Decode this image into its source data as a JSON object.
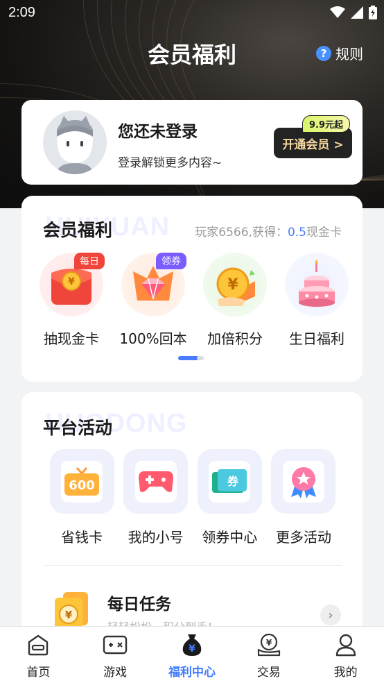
{
  "status": {
    "time": "2:09"
  },
  "header": {
    "title": "会员福利",
    "rules_label": "规则",
    "rules_icon": "question-icon"
  },
  "login": {
    "title": "您还未登录",
    "subtitle": "登录解锁更多内容~",
    "open_button": "开通会员 >",
    "price_tag": "9.9元起"
  },
  "benefits": {
    "heading": "会员福利",
    "watermark": "HUIYUAN",
    "note_prefix": "玩家6566,获得：",
    "note_value": "0.5",
    "note_suffix": "现金卡",
    "items": [
      {
        "label": "抽现金卡",
        "badge": "每日",
        "icon": "red-envelope-icon"
      },
      {
        "label": "100%回本",
        "badge": "领券",
        "icon": "gem-icon"
      },
      {
        "label": "加倍积分",
        "badge": "",
        "icon": "coin-icon"
      },
      {
        "label": "生日福利",
        "badge": "",
        "icon": "cake-icon"
      }
    ],
    "pager_active": 0
  },
  "platform": {
    "heading": "平台活动",
    "watermark": "HUODONG",
    "items": [
      {
        "label": "省钱卡",
        "icon": "gift-600-icon",
        "icon_text": "600"
      },
      {
        "label": "我的小号",
        "icon": "gamepad-icon",
        "icon_text": ""
      },
      {
        "label": "领券中心",
        "icon": "coupon-icon",
        "icon_text": "券"
      },
      {
        "label": "更多活动",
        "icon": "ribbon-badge-icon",
        "icon_text": ""
      }
    ],
    "task": {
      "title": "每日任务",
      "subtitle": "轻轻松松，积分到手！",
      "icon": "coin-card-icon"
    }
  },
  "tabs": [
    {
      "label": "首页",
      "icon": "home-icon",
      "active": false
    },
    {
      "label": "游戏",
      "icon": "game-icon",
      "active": false
    },
    {
      "label": "福利中心",
      "icon": "money-bag-icon",
      "active": true
    },
    {
      "label": "交易",
      "icon": "trade-icon",
      "active": false
    },
    {
      "label": "我的",
      "icon": "profile-icon",
      "active": false
    }
  ],
  "colors": {
    "accent": "#3f7bff",
    "gold": "#f6d9a0",
    "badge_red": "#f0453a",
    "badge_purple": "#7b5cff"
  }
}
